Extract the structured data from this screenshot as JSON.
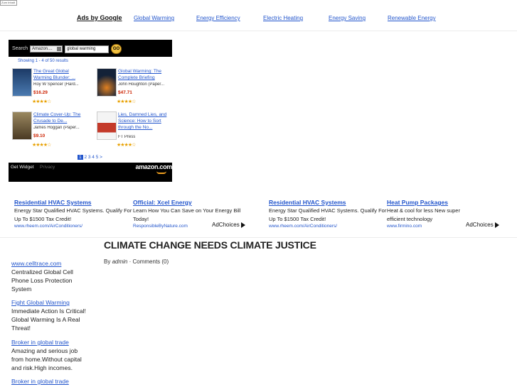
{
  "corner_image_alt": "Zum Inhalt",
  "link_unit": {
    "label": "Ads by Google",
    "topics": [
      "Global Warming",
      "Energy Efficiency",
      "Electric Heating",
      "Energy Saving",
      "Renewable Energy"
    ]
  },
  "widget": {
    "search_label": "Search",
    "category": "Amazon....",
    "query": "global warming",
    "go": "GO",
    "results": "Showing 1 - 4 of 50 results",
    "products": [
      {
        "title": "The Great Global Warming Blunder: ...",
        "author": "Roy W Spencer (Hard...",
        "price": "$16.29",
        "stars": "★★★★☆",
        "cover": "#1c3a66"
      },
      {
        "title": "Global Warming: The Complete Briefing",
        "author": "John Houghton (Paper...",
        "price": "$47.71",
        "stars": "★★★★☆",
        "cover": "#142238"
      },
      {
        "title": "Climate Cover-Up: The Crusade to De...",
        "author": "James Hoggan (Paper...",
        "price": "$9.10",
        "stars": "★★★★☆",
        "cover": "#6b5a3c"
      },
      {
        "title": "Lies, Damned Lies, and Science: How to Sort through the No...",
        "author": "FT Press",
        "price": "",
        "stars": "★★★★☆",
        "cover": "#c43a2a"
      }
    ],
    "pager": {
      "current": "1",
      "pages": "2 3 4 5 >"
    },
    "footer": {
      "get_widget": "Get Widget",
      "privacy": "Privacy",
      "logo": "amazon.com"
    }
  },
  "text_ads": [
    {
      "title": "Residential HVAC Systems",
      "desc": "Energy Star Qualified HVAC Systems. Qualify For Up To $1500 Tax Credit!",
      "url": "www.rheem.com/AirConditioners/"
    },
    {
      "title": "Official: Xcel Energy",
      "desc": "Learn How You Can Save on Your Energy Bill Today!",
      "url": "ResponsibleByNature.com"
    },
    {
      "title": "Residential HVAC Systems",
      "desc": "Energy Star Qualified HVAC Systems. Qualify For Up To $1500 Tax Credit!",
      "url": "www.rheem.com/AirConditioners/"
    },
    {
      "title": "Heat Pump Packages",
      "desc": "Heat & cool for less New super efficient technology",
      "url": "www.firmino.com"
    }
  ],
  "adchoices": "AdChoices",
  "sidebar_ads": [
    {
      "title": "www.celltrace.com",
      "desc": "Centralized Global Cell Phone Loss Protection System"
    },
    {
      "title": "Fight Global Warming",
      "desc": "Immediate Action Is Critical! Global Warming Is A Real Threat!"
    },
    {
      "title": "Broker in global trade",
      "desc": "Amazing and serious job from home.Without capital and risk.High incomes."
    },
    {
      "title": "Broker in global trade",
      "desc": ""
    }
  ],
  "post": {
    "title": "CLIMATE CHANGE NEEDS CLIMATE JUSTICE",
    "by": "By",
    "author": "admin",
    "comments": "· Comments (0)"
  }
}
